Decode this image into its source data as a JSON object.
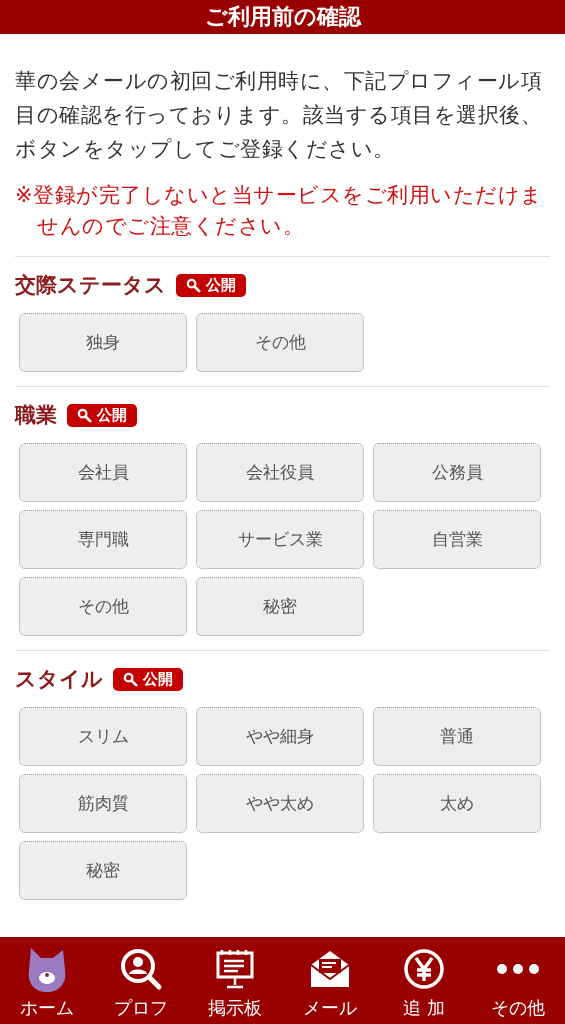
{
  "header": {
    "title": "ご利用前の確認"
  },
  "intro": "華の会メールの初回ご利用時に、下記プロフィール項目の確認を行っております。該当する項目を選択後、ボタンをタップしてご登録ください。",
  "warning": "※登録が完了しないと当サービスをご利用いただけませんのでご注意ください。",
  "sections": [
    {
      "title": "交際ステータス",
      "badge": "公開",
      "options": [
        "独身",
        "その他"
      ]
    },
    {
      "title": "職業",
      "badge": "公開",
      "options": [
        "会社員",
        "会社役員",
        "公務員",
        "専門職",
        "サービス業",
        "自営業",
        "その他",
        "秘密"
      ]
    },
    {
      "title": "スタイル",
      "badge": "公開",
      "options": [
        "スリム",
        "やや細身",
        "普通",
        "筋肉質",
        "やや太め",
        "太め",
        "秘密"
      ]
    }
  ],
  "nav": [
    {
      "kind": "home",
      "label": "ホーム"
    },
    {
      "kind": "profile",
      "label": "プロフ"
    },
    {
      "kind": "board",
      "label": "掲示板"
    },
    {
      "kind": "mail",
      "label": "メール"
    },
    {
      "kind": "add",
      "label": "追 加"
    },
    {
      "kind": "more",
      "label": "その他"
    }
  ]
}
